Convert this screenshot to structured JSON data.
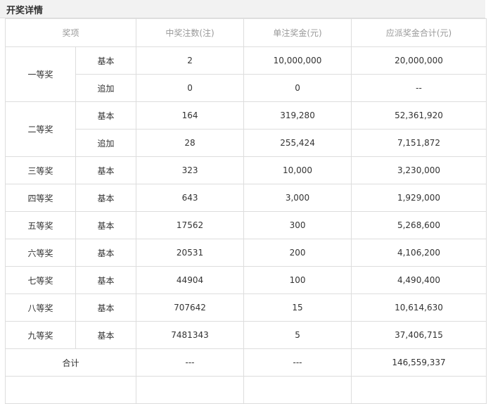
{
  "header": {
    "title": "开奖详情"
  },
  "table": {
    "columns": [
      "奖项",
      "中奖注数(注)",
      "单注奖金(元)",
      "应派奖金合计(元)"
    ],
    "prizes": [
      {
        "level": "一等奖",
        "rows": [
          {
            "type": "基本",
            "count": "2",
            "unit": "10,000,000",
            "total": "20,000,000"
          },
          {
            "type": "追加",
            "count": "0",
            "unit": "0",
            "total": "--"
          }
        ]
      },
      {
        "level": "二等奖",
        "rows": [
          {
            "type": "基本",
            "count": "164",
            "unit": "319,280",
            "total": "52,361,920"
          },
          {
            "type": "追加",
            "count": "28",
            "unit": "255,424",
            "total": "7,151,872"
          }
        ]
      },
      {
        "level": "三等奖",
        "rows": [
          {
            "type": "基本",
            "count": "323",
            "unit": "10,000",
            "total": "3,230,000"
          }
        ]
      },
      {
        "level": "四等奖",
        "rows": [
          {
            "type": "基本",
            "count": "643",
            "unit": "3,000",
            "total": "1,929,000"
          }
        ]
      },
      {
        "level": "五等奖",
        "rows": [
          {
            "type": "基本",
            "count": "17562",
            "unit": "300",
            "total": "5,268,600"
          }
        ]
      },
      {
        "level": "六等奖",
        "rows": [
          {
            "type": "基本",
            "count": "20531",
            "unit": "200",
            "total": "4,106,200"
          }
        ]
      },
      {
        "level": "七等奖",
        "rows": [
          {
            "type": "基本",
            "count": "44904",
            "unit": "100",
            "total": "4,490,400"
          }
        ]
      },
      {
        "level": "八等奖",
        "rows": [
          {
            "type": "基本",
            "count": "707642",
            "unit": "15",
            "total": "10,614,630"
          }
        ]
      },
      {
        "level": "九等奖",
        "rows": [
          {
            "type": "基本",
            "count": "7481343",
            "unit": "5",
            "total": "37,406,715"
          }
        ]
      }
    ],
    "summary": {
      "label": "合计",
      "count": "---",
      "unit": "---",
      "total": "146,559,337"
    }
  }
}
